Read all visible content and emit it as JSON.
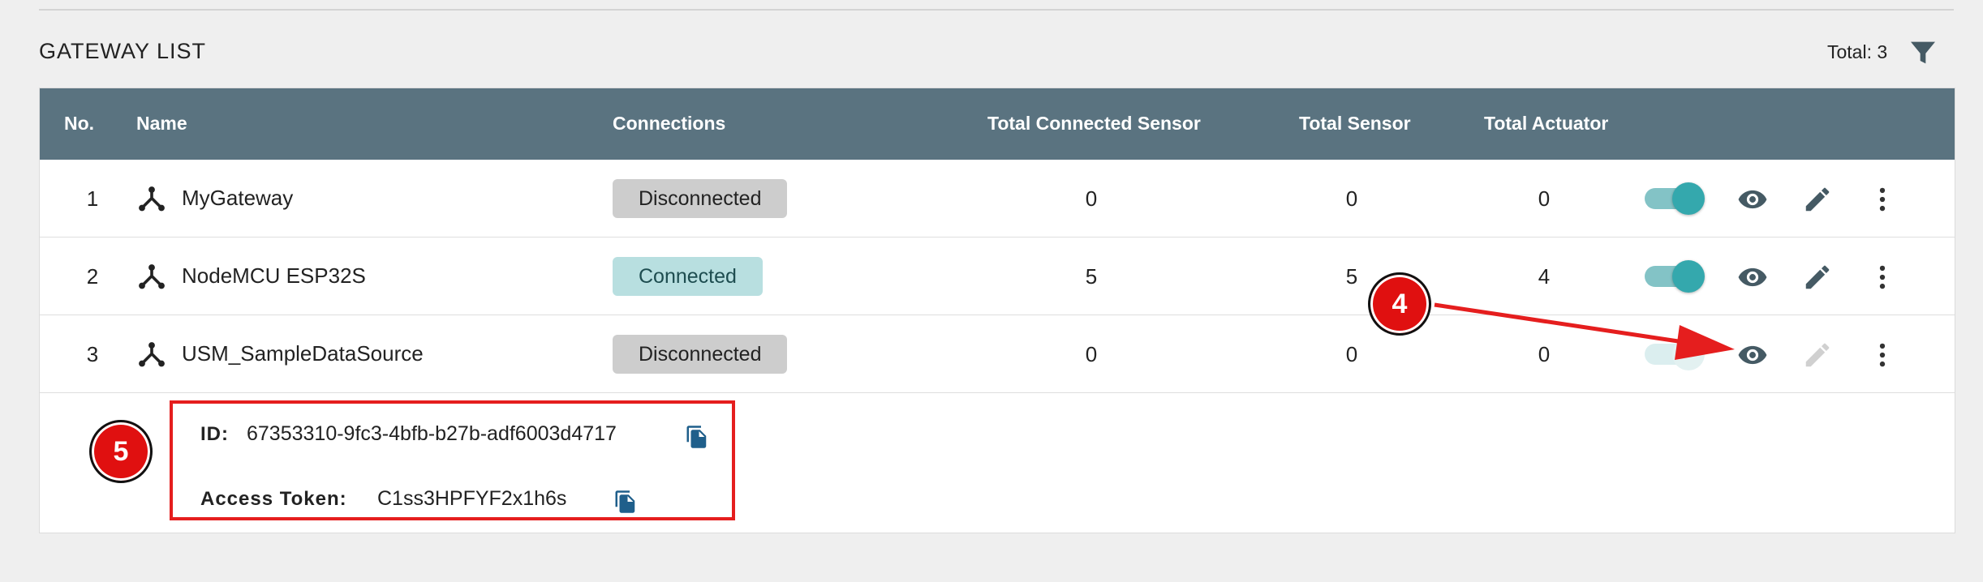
{
  "header": {
    "title": "GATEWAY LIST",
    "total": "Total: 3"
  },
  "table": {
    "columns": {
      "no": "No.",
      "name": "Name",
      "connections": "Connections",
      "total_connected_sensor": "Total Connected Sensor",
      "total_sensor": "Total Sensor",
      "total_actuator": "Total Actuator"
    },
    "rows": [
      {
        "no": "1",
        "name": "MyGateway",
        "connection": "Disconnected",
        "connected_sensor": "0",
        "sensor": "0",
        "actuator": "0",
        "enabled": true
      },
      {
        "no": "2",
        "name": "NodeMCU ESP32S",
        "connection": "Connected",
        "connected_sensor": "5",
        "sensor": "5",
        "actuator": "4",
        "enabled": true
      },
      {
        "no": "3",
        "name": "USM_SampleDataSource",
        "connection": "Disconnected",
        "connected_sensor": "0",
        "sensor": "0",
        "actuator": "0",
        "enabled": false
      }
    ]
  },
  "details": {
    "id_label": "ID:",
    "id_value": "67353310-9fc3-4bfb-b27b-adf6003d4717",
    "token_label": "Access Token:",
    "token_value": "C1ss3HPFYF2x1h6s"
  },
  "annotations": {
    "step4": "4",
    "step5": "5"
  },
  "colors": {
    "header_bg": "#5a7380",
    "accent_teal": "#34a8ad",
    "connected_bg": "#b8dfe0",
    "disconnected_bg": "#cdcdcd",
    "annotation_red": "#e01010",
    "icon_dark": "#455a64"
  },
  "icons": [
    "filter-icon",
    "gateway-icon",
    "eye-icon",
    "pencil-icon",
    "more-vertical-icon",
    "copy-icon"
  ]
}
